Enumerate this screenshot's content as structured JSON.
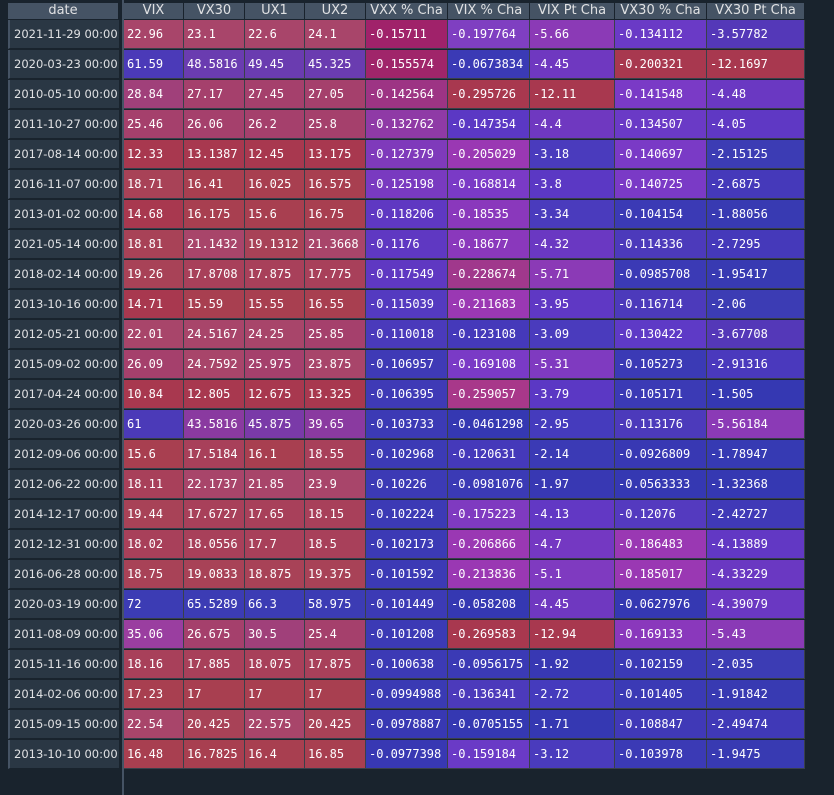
{
  "header": {
    "index_label": "date",
    "columns": [
      "VIX",
      "VX30",
      "UX1",
      "UX2",
      "VXX % Cha",
      "VIX % Cha",
      "VIX Pt Cha",
      "VX30 % Cha",
      "VX30 Pt Cha"
    ]
  },
  "rows": [
    {
      "date": "2021-11-29 00:00:00",
      "cells": [
        "22.96",
        "23.1",
        "22.6",
        "24.1",
        "-0.15711",
        "-0.197764",
        "-5.66",
        "-0.134112",
        "-3.57782"
      ],
      "colors": [
        "#a8456a",
        "#a8456a",
        "#a8456a",
        "#a8456a",
        "#a0226a",
        "#7f3fc1",
        "#8b3ab6",
        "#6a3ac6",
        "#5438b8"
      ]
    },
    {
      "date": "2020-03-23 00:00:00",
      "cells": [
        "61.59",
        "48.5816",
        "49.45",
        "45.325",
        "-0.155574",
        "-0.0673834",
        "-4.45",
        "-0.200321",
        "-12.1697"
      ],
      "colors": [
        "#4b3ab8",
        "#6a3cb0",
        "#6a3cb0",
        "#6a3cb0",
        "#a0256a",
        "#3b3ab5",
        "#6f38c0",
        "#a8384f",
        "#a8384f"
      ]
    },
    {
      "date": "2010-05-10 00:00:00",
      "cells": [
        "28.84",
        "27.17",
        "27.45",
        "27.05",
        "-0.142564",
        "-0.295726",
        "-12.11",
        "-0.141548",
        "-4.48"
      ],
      "colors": [
        "#a0407a",
        "#a5406c",
        "#a5406c",
        "#a5406c",
        "#9d3484",
        "#a8384f",
        "#a8384f",
        "#7a3ac6",
        "#6a38c2"
      ]
    },
    {
      "date": "2011-10-27 00:00:00",
      "cells": [
        "25.46",
        "26.06",
        "26.2",
        "25.8",
        "-0.132762",
        "-0.147354",
        "-4.4",
        "-0.134507",
        "-4.05"
      ],
      "colors": [
        "#a5406c",
        "#a5406c",
        "#a5406c",
        "#a5406c",
        "#8f3aa6",
        "#5b38c4",
        "#6f38c0",
        "#6a3ac6",
        "#5f38c4"
      ]
    },
    {
      "date": "2017-08-14 00:00:00",
      "cells": [
        "12.33",
        "13.1387",
        "12.45",
        "13.175",
        "-0.127379",
        "-0.205029",
        "-3.18",
        "-0.140697",
        "-2.15125"
      ],
      "colors": [
        "#a8384f",
        "#a8384f",
        "#a8384f",
        "#a8384f",
        "#7f3abb",
        "#9a38b3",
        "#4a3bbd",
        "#7a3ac6",
        "#3c3cb4"
      ]
    },
    {
      "date": "2016-11-07 00:00:00",
      "cells": [
        "18.71",
        "16.41",
        "16.025",
        "16.575",
        "-0.125198",
        "-0.168814",
        "-3.8",
        "-0.140725",
        "-2.6875"
      ],
      "colors": [
        "#a84257",
        "#a83f50",
        "#a83f50",
        "#a83f50",
        "#793ac0",
        "#7a3ac6",
        "#5b38c4",
        "#7a3ac6",
        "#4539ba"
      ]
    },
    {
      "date": "2013-01-02 00:00:00",
      "cells": [
        "14.68",
        "16.175",
        "15.6",
        "16.75",
        "-0.118206",
        "-0.18535",
        "-3.34",
        "-0.104154",
        "-1.88056"
      ],
      "colors": [
        "#a8384f",
        "#a83f50",
        "#a83f50",
        "#a83f50",
        "#5f38c2",
        "#8a38bc",
        "#4a3bbd",
        "#3b3ab5",
        "#383ab2"
      ]
    },
    {
      "date": "2021-05-14 00:00:00",
      "cells": [
        "18.81",
        "21.1432",
        "19.1312",
        "21.3668",
        "-0.1176",
        "-0.18677",
        "-4.32",
        "-0.114336",
        "-2.7295"
      ],
      "colors": [
        "#a84257",
        "#a8456a",
        "#a84257",
        "#a8456a",
        "#5f38c2",
        "#8a38bc",
        "#6a38c2",
        "#4c3abb",
        "#4539ba"
      ]
    },
    {
      "date": "2018-02-14 00:00:00",
      "cells": [
        "19.26",
        "17.8708",
        "17.875",
        "17.775",
        "-0.117549",
        "-0.228674",
        "-5.71",
        "-0.0985708",
        "-1.95417"
      ],
      "colors": [
        "#a84257",
        "#a8405a",
        "#a8405a",
        "#a8405a",
        "#5f38c2",
        "#a0388c",
        "#8b3ab6",
        "#3b3ab5",
        "#383ab2"
      ]
    },
    {
      "date": "2013-10-16 00:00:00",
      "cells": [
        "14.71",
        "15.59",
        "15.55",
        "16.55",
        "-0.115039",
        "-0.211683",
        "-3.95",
        "-0.116714",
        "-2.06"
      ],
      "colors": [
        "#a8384f",
        "#a83f50",
        "#a83f50",
        "#a83f50",
        "#543ac0",
        "#9a38b3",
        "#5f38c4",
        "#4c3abb",
        "#3c3cb4"
      ]
    },
    {
      "date": "2012-05-21 00:00:00",
      "cells": [
        "22.01",
        "24.5167",
        "24.25",
        "25.85",
        "-0.110018",
        "-0.123108",
        "-3.09",
        "-0.130422",
        "-3.67708"
      ],
      "colors": [
        "#a8456a",
        "#a8456a",
        "#a8456a",
        "#a5406c",
        "#4a3abb",
        "#4539ba",
        "#4a3bbd",
        "#5e3ac6",
        "#5438b8"
      ]
    },
    {
      "date": "2015-09-02 00:00:00",
      "cells": [
        "26.09",
        "24.7592",
        "25.975",
        "23.875",
        "-0.106957",
        "-0.169108",
        "-5.31",
        "-0.105273",
        "-2.91316"
      ],
      "colors": [
        "#a5406c",
        "#a8456a",
        "#a5406c",
        "#a8456a",
        "#3f3ab6",
        "#7a3ac6",
        "#7f3ac0",
        "#3b3ab5",
        "#4a39bd"
      ]
    },
    {
      "date": "2017-04-24 00:00:00",
      "cells": [
        "10.84",
        "12.805",
        "12.675",
        "13.325",
        "-0.106395",
        "-0.259057",
        "-3.79",
        "-0.105171",
        "-1.505"
      ],
      "colors": [
        "#a8384f",
        "#a8384f",
        "#a8384f",
        "#a8384f",
        "#3f3ab6",
        "#a8388a",
        "#5b38c4",
        "#3b3ab5",
        "#3538b2"
      ]
    },
    {
      "date": "2020-03-26 00:00:00",
      "cells": [
        "61",
        "43.5816",
        "45.875",
        "39.65",
        "-0.103733",
        "-0.0461298",
        "-2.95",
        "-0.113176",
        "-5.56184"
      ],
      "colors": [
        "#4b3ab8",
        "#8a3aa0",
        "#7a3aa8",
        "#8a3aa0",
        "#3c3ab5",
        "#3538b2",
        "#453bbd",
        "#4c3abb",
        "#8b3ab6"
      ]
    },
    {
      "date": "2012-09-06 00:00:00",
      "cells": [
        "15.6",
        "17.5184",
        "16.1",
        "18.55",
        "-0.102968",
        "-0.120631",
        "-2.14",
        "-0.0926809",
        "-1.78947"
      ],
      "colors": [
        "#a83f50",
        "#a8405a",
        "#a83f50",
        "#a8405a",
        "#3c3ab5",
        "#4539ba",
        "#3b3ab5",
        "#3838b3",
        "#363ab3"
      ]
    },
    {
      "date": "2012-06-22 00:00:00",
      "cells": [
        "18.11",
        "22.1737",
        "21.85",
        "23.9",
        "-0.10226",
        "-0.0981076",
        "-1.97",
        "-0.0563333",
        "-1.32368"
      ],
      "colors": [
        "#a8405a",
        "#a8456a",
        "#a8456a",
        "#a8456a",
        "#3c3ab5",
        "#3b3ab5",
        "#3838b3",
        "#3538b2",
        "#3538b2"
      ]
    },
    {
      "date": "2014-12-17 00:00:00",
      "cells": [
        "19.44",
        "17.6727",
        "17.65",
        "18.15",
        "-0.102224",
        "-0.175223",
        "-4.13",
        "-0.12076",
        "-2.42727"
      ],
      "colors": [
        "#a84257",
        "#a8405a",
        "#a8405a",
        "#a8405a",
        "#3c3ab5",
        "#7f3ac0",
        "#6238c4",
        "#543abf",
        "#4039b7"
      ]
    },
    {
      "date": "2012-12-31 00:00:00",
      "cells": [
        "18.02",
        "18.0556",
        "17.7",
        "18.5",
        "-0.102173",
        "-0.206866",
        "-4.7",
        "-0.186483",
        "-4.13889"
      ],
      "colors": [
        "#a8405a",
        "#a8405a",
        "#a8405a",
        "#a8405a",
        "#3c3ab5",
        "#9a38b3",
        "#7438c2",
        "#9a38b3",
        "#6238c4"
      ]
    },
    {
      "date": "2016-06-28 00:00:00",
      "cells": [
        "18.75",
        "19.0833",
        "18.875",
        "19.375",
        "-0.101592",
        "-0.213836",
        "-5.1",
        "-0.185017",
        "-4.33229"
      ],
      "colors": [
        "#a84257",
        "#a84257",
        "#a84257",
        "#a84257",
        "#3c3ab5",
        "#9a38b3",
        "#7f3ac0",
        "#9a38b3",
        "#6a38c2"
      ]
    },
    {
      "date": "2020-03-19 00:00:00",
      "cells": [
        "72",
        "65.5289",
        "66.3",
        "58.975",
        "-0.101449",
        "-0.058208",
        "-4.45",
        "-0.0627976",
        "-4.39079"
      ],
      "colors": [
        "#3c3cb4",
        "#3c3cb4",
        "#3c3cb4",
        "#3c3cb4",
        "#3c3ab5",
        "#3538b2",
        "#6f38c0",
        "#3538b2",
        "#6a38c2"
      ]
    },
    {
      "date": "2011-08-09 00:00:00",
      "cells": [
        "35.06",
        "26.675",
        "30.5",
        "25.4",
        "-0.101208",
        "-0.269583",
        "-12.94",
        "-0.169133",
        "-5.43"
      ],
      "colors": [
        "#9a3ea0",
        "#a5406c",
        "#a0407a",
        "#a5406c",
        "#3c3ab5",
        "#a8384f",
        "#a8384f",
        "#8a38bc",
        "#8a3ab6"
      ]
    },
    {
      "date": "2015-11-16 00:00:00",
      "cells": [
        "18.16",
        "17.885",
        "18.075",
        "17.875",
        "-0.100638",
        "-0.0956175",
        "-1.92",
        "-0.102159",
        "-2.035"
      ],
      "colors": [
        "#a8405a",
        "#a8405a",
        "#a8405a",
        "#a8405a",
        "#3c3ab5",
        "#3b3ab5",
        "#3838b3",
        "#3b3ab5",
        "#3c3cb4"
      ]
    },
    {
      "date": "2014-02-06 00:00:00",
      "cells": [
        "17.23",
        "17",
        "17",
        "17",
        "-0.0994988",
        "-0.136341",
        "-2.72",
        "-0.101405",
        "-1.91842"
      ],
      "colors": [
        "#a83f50",
        "#a83f50",
        "#a83f50",
        "#a83f50",
        "#3a3ab4",
        "#4c3abb",
        "#453bbd",
        "#3b3ab5",
        "#383ab2"
      ]
    },
    {
      "date": "2015-09-15 00:00:00",
      "cells": [
        "22.54",
        "20.425",
        "22.575",
        "20.425",
        "-0.0978887",
        "-0.0705155",
        "-1.71",
        "-0.108847",
        "-2.49474"
      ],
      "colors": [
        "#a8456a",
        "#a84257",
        "#a8456a",
        "#a84257",
        "#3838b3",
        "#3538b2",
        "#3538b2",
        "#4039b7",
        "#4039b7"
      ]
    },
    {
      "date": "2013-10-10 00:00:00",
      "cells": [
        "16.48",
        "16.7825",
        "16.4",
        "16.85",
        "-0.0977398",
        "-0.159184",
        "-3.12",
        "-0.103978",
        "-1.9475"
      ],
      "colors": [
        "#a83f50",
        "#a83f50",
        "#a83f50",
        "#a83f50",
        "#3838b3",
        "#6a3ac6",
        "#4a3bbd",
        "#3b3ab5",
        "#383ab2"
      ]
    }
  ]
}
